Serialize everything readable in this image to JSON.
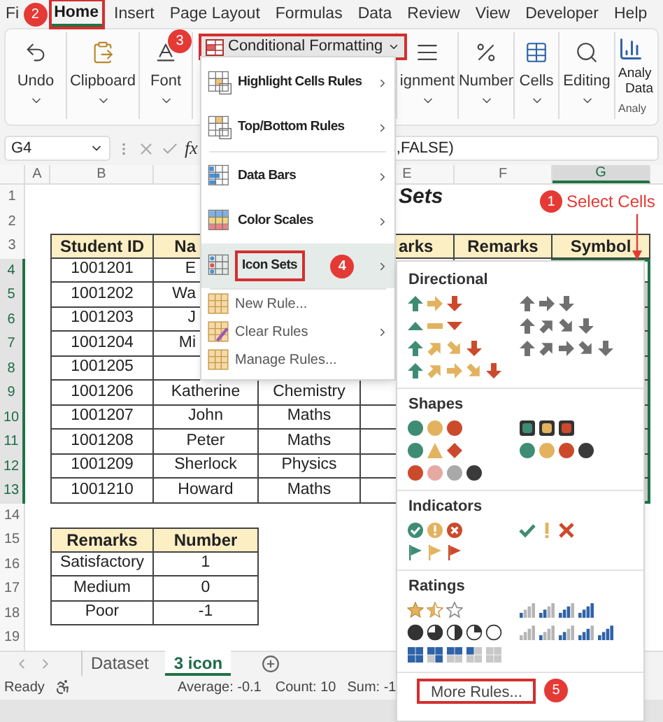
{
  "ribbon_tabs": [
    {
      "label": "Fi",
      "selected": false
    },
    {
      "label": "Home",
      "selected": true,
      "badge": "2"
    },
    {
      "label": "Insert",
      "selected": false
    },
    {
      "label": "Page Layout",
      "selected": false
    },
    {
      "label": "Formulas",
      "selected": false
    },
    {
      "label": "Data",
      "selected": false
    },
    {
      "label": "Review",
      "selected": false
    },
    {
      "label": "View",
      "selected": false
    },
    {
      "label": "Developer",
      "selected": false
    },
    {
      "label": "Help",
      "selected": false
    }
  ],
  "ribbon_groups_left": [
    {
      "label": "Undo"
    },
    {
      "label": "Clipboard"
    },
    {
      "label": "Font"
    }
  ],
  "conditional_formatting": {
    "label": "Conditional Formatting",
    "expanded": true,
    "badge": "3"
  },
  "ribbon_groups_right": [
    {
      "label": "ignment"
    },
    {
      "label": "Number"
    },
    {
      "label": "Cells"
    },
    {
      "label": "Editing"
    }
  ],
  "analyze": {
    "lines": [
      "Analy",
      "Data"
    ],
    "group_label": "Analy"
  },
  "formula_bar": {
    "name_box": "G4",
    "fx": "fx",
    "formula": ",FALSE)"
  },
  "column_headers": [
    {
      "label": "A",
      "selected": false
    },
    {
      "label": "B",
      "selected": false
    },
    {
      "label": "E",
      "selected": false
    },
    {
      "label": "F",
      "selected": false
    },
    {
      "label": "G",
      "selected": true
    }
  ],
  "row_numbers": [
    {
      "label": "1",
      "selected": false
    },
    {
      "label": "2",
      "selected": false
    },
    {
      "label": "3",
      "selected": false
    },
    {
      "label": "4",
      "selected": true
    },
    {
      "label": "5",
      "selected": true
    },
    {
      "label": "6",
      "selected": true
    },
    {
      "label": "7",
      "selected": true
    },
    {
      "label": "8",
      "selected": true
    },
    {
      "label": "9",
      "selected": true
    },
    {
      "label": "10",
      "selected": true
    },
    {
      "label": "11",
      "selected": true
    },
    {
      "label": "12",
      "selected": true
    },
    {
      "label": "13",
      "selected": true
    },
    {
      "label": "14",
      "selected": false
    },
    {
      "label": "15",
      "selected": false
    },
    {
      "label": "16",
      "selected": false
    },
    {
      "label": "17",
      "selected": false
    },
    {
      "label": "18",
      "selected": false
    },
    {
      "label": "19",
      "selected": false
    }
  ],
  "sheet_title": "Sets",
  "select_cells_note": {
    "badge": "1",
    "text": "Select Cells"
  },
  "main_table": {
    "headers": [
      "Student ID",
      "Na",
      "arks",
      "Remarks",
      "Symbol"
    ],
    "rows": [
      {
        "student_id": "1001201",
        "name": "E",
        "symbol": {
          "selected": true,
          "active": true
        }
      },
      {
        "student_id": "1001202",
        "name": "Wa",
        "symbol": {
          "selected": true,
          "active": false
        }
      },
      {
        "student_id": "1001203",
        "name": "J",
        "symbol": {
          "selected": true,
          "active": false
        }
      },
      {
        "student_id": "1001204",
        "name": "Mi",
        "symbol": {
          "selected": true,
          "active": false
        }
      },
      {
        "student_id": "1001205",
        "symbol": {
          "selected": true,
          "active": false
        }
      },
      {
        "student_id": "1001206",
        "name": "Katherine",
        "subject": "Chemistry",
        "symbol": {
          "selected": true,
          "active": false
        }
      },
      {
        "student_id": "1001207",
        "name": "John",
        "subject": "Maths",
        "symbol": {
          "selected": true,
          "active": false
        }
      },
      {
        "student_id": "1001208",
        "name": "Peter",
        "subject": "Maths",
        "symbol": {
          "selected": true,
          "active": false
        }
      },
      {
        "student_id": "1001209",
        "name": "Sherlock",
        "subject": "Physics",
        "symbol": {
          "selected": true,
          "active": false
        }
      },
      {
        "student_id": "1001210",
        "name": "Howard",
        "subject": "Maths",
        "symbol": {
          "selected": true,
          "active": false
        }
      }
    ]
  },
  "remarks_table": {
    "headers": [
      "Remarks",
      "Number"
    ],
    "rows": [
      [
        "Satisfactory",
        "1"
      ],
      [
        "Medium",
        "0"
      ],
      [
        "Poor",
        "-1"
      ]
    ]
  },
  "cf_menu": [
    {
      "label": "Highlight Cells Rules",
      "kind": "large",
      "submenu": true,
      "selected": false
    },
    {
      "label": "Top/Bottom Rules",
      "kind": "large",
      "submenu": true,
      "selected": false
    },
    {
      "label": "Data Bars",
      "kind": "large",
      "submenu": true,
      "selected": false
    },
    {
      "label": "Color Scales",
      "kind": "large",
      "submenu": true,
      "selected": false
    },
    {
      "label": "Icon Sets",
      "kind": "large",
      "submenu": true,
      "selected": true,
      "badge": "4"
    },
    {
      "label": "New Rule...",
      "kind": "small",
      "submenu": false,
      "selected": false
    },
    {
      "label": "Clear Rules",
      "kind": "small",
      "submenu": true,
      "selected": false
    },
    {
      "label": "Manage Rules...",
      "kind": "small",
      "submenu": false,
      "selected": false
    }
  ],
  "icon_sets_menu": {
    "sections": [
      "Directional",
      "Shapes",
      "Indicators",
      "Ratings"
    ],
    "more_rules": {
      "label": "More Rules...",
      "badge": "5"
    }
  },
  "sheet_tabs": [
    {
      "label": "Dataset",
      "selected": false
    },
    {
      "label": "3 icon",
      "selected": true
    }
  ],
  "status_bar": {
    "mode": "Ready",
    "average": "Average: -0.1",
    "count": "Count: 10",
    "sum": "Sum: -1"
  }
}
